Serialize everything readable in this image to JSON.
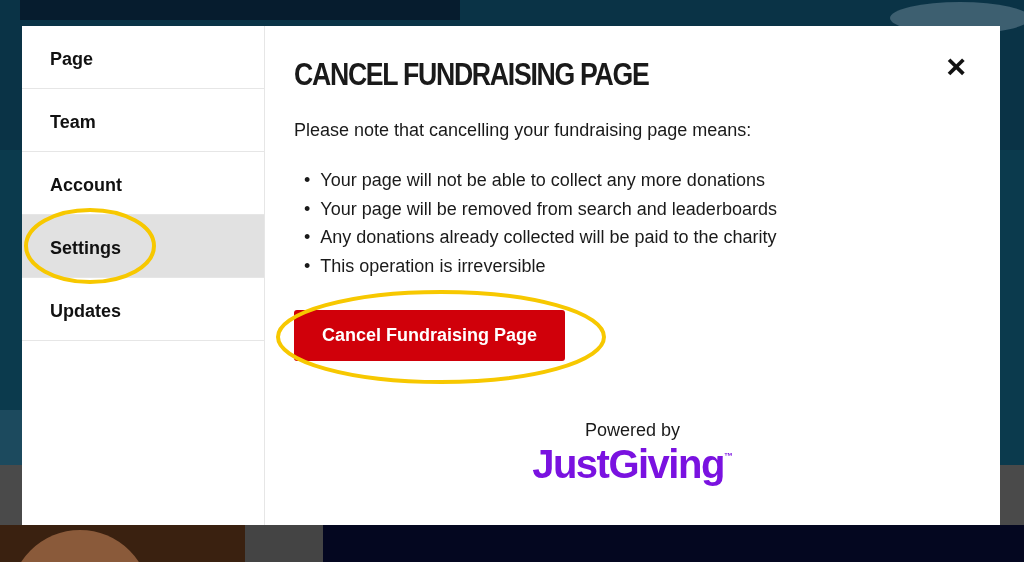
{
  "sidebar": {
    "items": [
      {
        "label": "Page",
        "selected": false,
        "highlighted": false
      },
      {
        "label": "Team",
        "selected": false,
        "highlighted": false
      },
      {
        "label": "Account",
        "selected": false,
        "highlighted": false
      },
      {
        "label": "Settings",
        "selected": true,
        "highlighted": true
      },
      {
        "label": "Updates",
        "selected": false,
        "highlighted": false
      }
    ]
  },
  "dialog": {
    "title": "CANCEL FUNDRAISING PAGE",
    "close": "×",
    "intro": "Please note that cancelling your fundraising page means:",
    "points": [
      {
        "bullet": "•",
        "text": "Your page will not be able to collect any more donations"
      },
      {
        "bullet": "•",
        "text": "Your page will be removed from search and leaderboards"
      },
      {
        "bullet": "•",
        "text": "Any donations already collected will be paid to the charity"
      },
      {
        "bullet": "•",
        "text": "This operation is irreversible"
      }
    ],
    "button": {
      "label": "Cancel Fundraising Page",
      "highlighted": true
    },
    "powered_by": "Powered by",
    "logo": "JustGiving",
    "trademark": "™"
  }
}
